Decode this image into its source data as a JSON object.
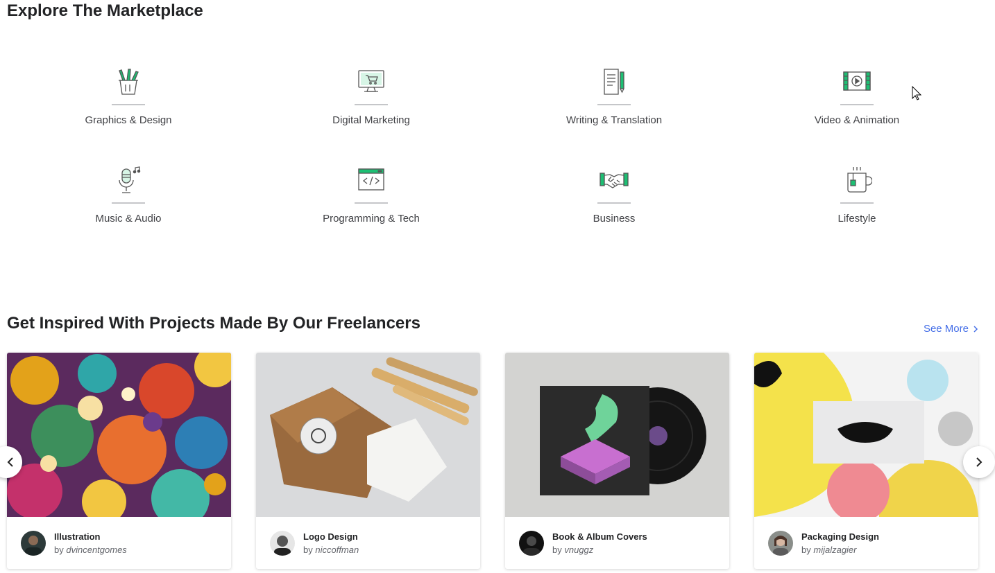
{
  "marketplace": {
    "title": "Explore The Marketplace",
    "categories": [
      {
        "label": "Graphics & Design",
        "icon": "pencil-cup-icon"
      },
      {
        "label": "Digital Marketing",
        "icon": "monitor-cart-icon"
      },
      {
        "label": "Writing & Translation",
        "icon": "document-pen-icon"
      },
      {
        "label": "Video & Animation",
        "icon": "film-play-icon"
      },
      {
        "label": "Music & Audio",
        "icon": "microphone-note-icon"
      },
      {
        "label": "Programming & Tech",
        "icon": "browser-code-icon"
      },
      {
        "label": "Business",
        "icon": "handshake-icon"
      },
      {
        "label": "Lifestyle",
        "icon": "mug-icon"
      }
    ]
  },
  "inspired": {
    "title": "Get Inspired With Projects Made By Our Freelancers",
    "see_more": "See More",
    "projects": [
      {
        "title": "Illustration",
        "by": "by",
        "author": "dvincentgomes"
      },
      {
        "title": "Logo Design",
        "by": "by",
        "author": "niccoffman"
      },
      {
        "title": "Book & Album Covers",
        "by": "by",
        "author": "vnuggz"
      },
      {
        "title": "Packaging Design",
        "by": "by",
        "author": "mijalzagier"
      }
    ]
  },
  "colors": {
    "accent_green": "#1dbf73",
    "link_blue": "#446ee7",
    "heading": "#222325"
  }
}
